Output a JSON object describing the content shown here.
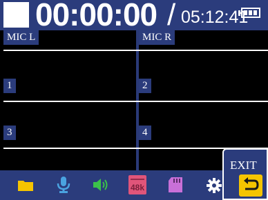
{
  "status": {
    "elapsed_time": "00:00:00",
    "separator": "/",
    "remaining_time": "05:12:41",
    "battery_icon": "battery-full-icon"
  },
  "tracks": [
    {
      "label": "MIC L"
    },
    {
      "label": "MIC R"
    },
    {
      "label": "1"
    },
    {
      "label": "2"
    },
    {
      "label": "3"
    },
    {
      "label": "4"
    }
  ],
  "toolbar": {
    "items": [
      {
        "icon": "folder-icon",
        "color": "#f5c400"
      },
      {
        "icon": "microphone-icon",
        "color": "#4aa3e0"
      },
      {
        "icon": "speaker-icon",
        "color": "#3cc24a"
      },
      {
        "icon": "sample-rate-48k-icon",
        "text": "48k",
        "color": "#e0557a"
      },
      {
        "icon": "sd-card-icon",
        "color": "#c970d8"
      },
      {
        "icon": "gear-icon",
        "color": "#ffffff"
      }
    ],
    "exit_label": "EXIT",
    "exit_icon": "return-arrow-icon"
  },
  "colors": {
    "bar_blue": "#2b3c7c",
    "background": "#000000",
    "accent_yellow": "#f5c400"
  }
}
